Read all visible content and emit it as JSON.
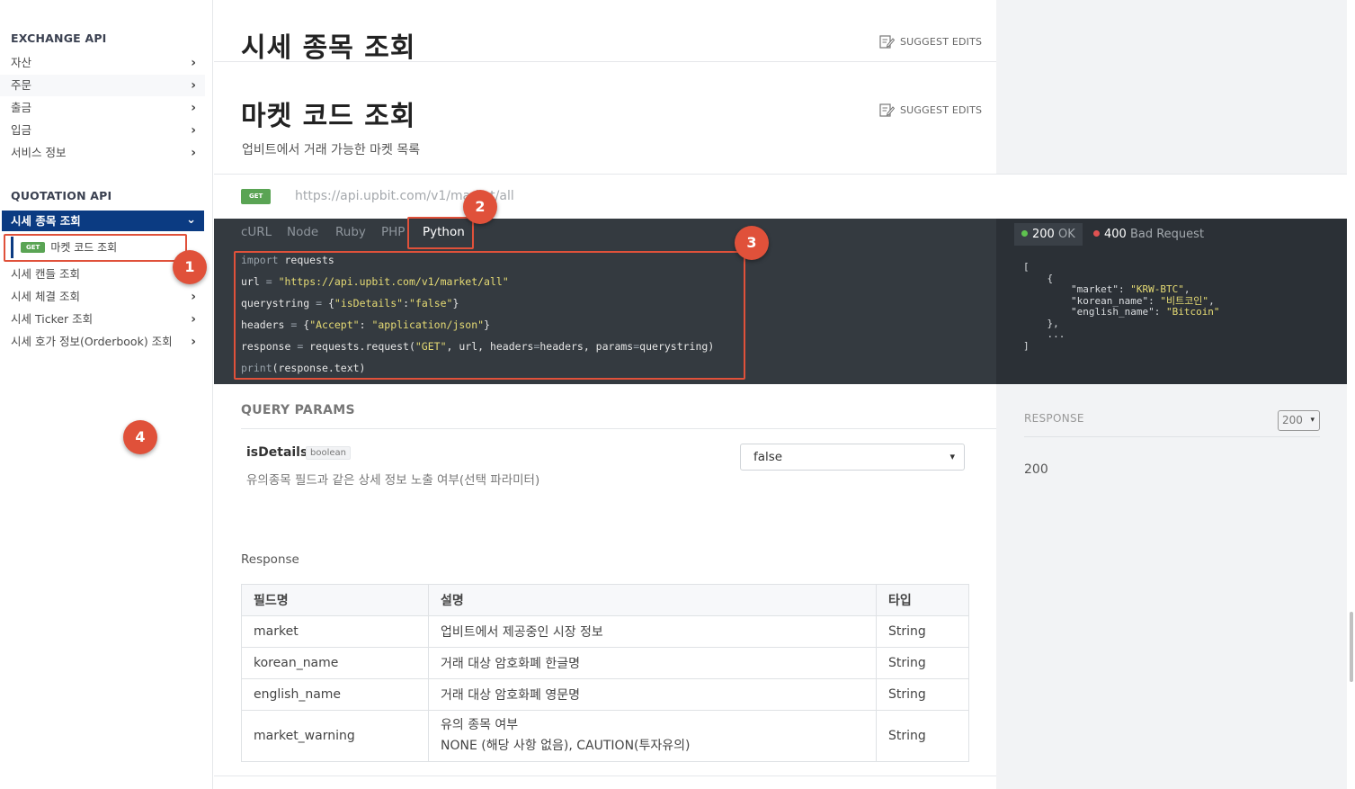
{
  "sidebar": {
    "exchange_title": "EXCHANGE API",
    "exchange_items": [
      {
        "label": "자산"
      },
      {
        "label": "주문"
      },
      {
        "label": "출금"
      },
      {
        "label": "입금"
      },
      {
        "label": "서비스 정보"
      }
    ],
    "quotation_title": "QUOTATION API",
    "active_section": "시세 종목 조회",
    "sub_item": {
      "method": "GET",
      "label": "마켓 코드 조회"
    },
    "quotation_items": [
      {
        "label": "시세 캔들 조회"
      },
      {
        "label": "시세 체결 조회"
      },
      {
        "label": "시세 Ticker 조회"
      },
      {
        "label": "시세 호가 정보(Orderbook) 조회"
      }
    ]
  },
  "annotations": [
    "1",
    "2",
    "3",
    "4"
  ],
  "main": {
    "section_title": "시세 종목 조회",
    "suggest_edits": "SUGGEST EDITS",
    "page_title": "마켓 코드 조회",
    "description": "업비트에서 거래 가능한 마켓 목록",
    "method": "GET",
    "url": "https://api.upbit.com/v1/market/all",
    "code_tabs": [
      "cURL",
      "Node",
      "Ruby",
      "PHP",
      "Python"
    ],
    "active_tab": "Python",
    "code_lines": [
      "import requests",
      "url = \"https://api.upbit.com/v1/market/all\"",
      "querystring = {\"isDetails\":\"false\"}",
      "headers = {\"Accept\": \"application/json\"}",
      "response = requests.request(\"GET\", url, headers=headers, params=querystring)",
      "print(response.text)"
    ],
    "query_params_title": "QUERY PARAMS",
    "param": {
      "name": "isDetails",
      "type": "boolean",
      "description": "유의종목 필드과 같은 상세 정보 노출 여부(선택 파라미터)",
      "value": "false"
    },
    "response_label": "Response",
    "table": {
      "headers": [
        "필드명",
        "설명",
        "타입"
      ],
      "rows": [
        {
          "field": "market",
          "desc": "업비트에서 제공중인 시장 정보",
          "type": "String"
        },
        {
          "field": "korean_name",
          "desc": "거래 대상 암호화폐 한글명",
          "type": "String"
        },
        {
          "field": "english_name",
          "desc": "거래 대상 암호화폐 영문명",
          "type": "String"
        },
        {
          "field": "market_warning",
          "desc": "유의 종목 여부",
          "desc2": "NONE (해당 사항 없음), CAUTION(투자유의)",
          "type": "String"
        }
      ]
    }
  },
  "response_panel": {
    "status_ok_code": "200",
    "status_ok_text": "OK",
    "status_bad_code": "400",
    "status_bad_text": "Bad Request",
    "json_lines": [
      "[",
      "    {",
      "        \"market\": \"KRW-BTC\",",
      "        \"korean_name\": \"비트코인\",",
      "        \"english_name\": \"Bitcoin\"",
      "    },",
      "    ...",
      "]"
    ],
    "response_title": "RESPONSE",
    "response_select": "200",
    "response_code": "200"
  },
  "colors": {
    "nav_active": "#0b3b82",
    "get_badge": "#5aa454",
    "annotation": "#e0513a",
    "ok_dot": "#5ec24f",
    "bad_dot": "#e05252"
  }
}
